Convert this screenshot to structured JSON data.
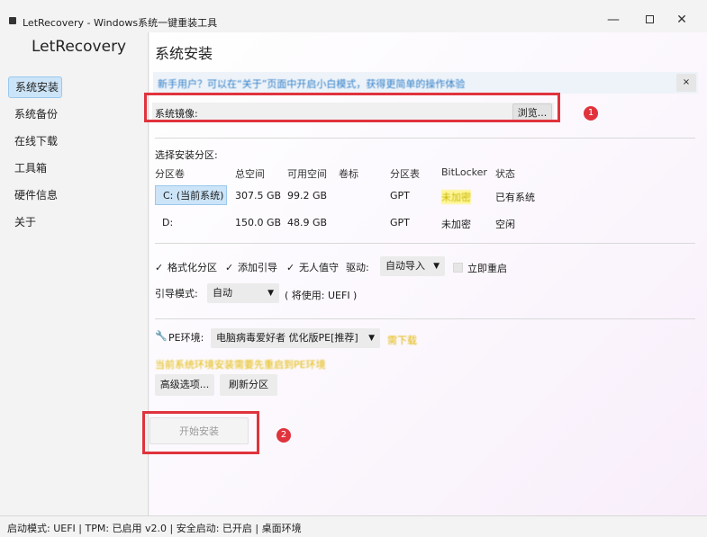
{
  "window": {
    "title": "LetRecovery - Windows系统一键重装工具"
  },
  "sidebar": {
    "app_name": "LetRecovery",
    "items": [
      {
        "label": "系统安装",
        "active": true
      },
      {
        "label": "系统备份"
      },
      {
        "label": "在线下载"
      },
      {
        "label": "工具箱"
      },
      {
        "label": "硬件信息"
      },
      {
        "label": "关于"
      }
    ]
  },
  "main": {
    "page_title": "系统安装",
    "tip": {
      "text": "新手用户？可以在“关于”页面中开启小白模式，获得更简单的操作体验",
      "close": "×"
    },
    "image_row": {
      "label": "系统镜像:",
      "browse_label": "浏览..."
    },
    "partition_section": {
      "label": "选择安装分区:"
    },
    "table": {
      "headers": [
        "分区卷",
        "总空间",
        "可用空间",
        "卷标",
        "分区表",
        "BitLocker",
        "状态"
      ],
      "rows": [
        {
          "volume": "C: (当前系统)",
          "total": "307.5 GB",
          "free": "99.2 GB",
          "label": "",
          "table": "GPT",
          "bitlocker": "未加密",
          "status": "已有系统",
          "selected": true
        },
        {
          "volume": "D:",
          "total": "150.0 GB",
          "free": "48.9 GB",
          "label": "",
          "table": "GPT",
          "bitlocker": "未加密",
          "status": "空闲",
          "selected": false
        }
      ]
    },
    "options": {
      "format": "格式化分区",
      "add_boot": "添加引导",
      "unattended": "无人值守",
      "driver_label": "驱动:",
      "driver_value": "自动导入",
      "reboot": "立即重启",
      "check_mark": "✓",
      "boot_mode_label": "引导模式:",
      "boot_mode_value": "自动",
      "boot_mode_note": "( 将使用: UEFI )"
    },
    "pe": {
      "label": "PE环境:",
      "value": "电脑病毒爱好者 优化版PE[推荐]",
      "download_link": "需下载",
      "warning": "当前系统环境安装需要先重启到PE环境"
    },
    "buttons": {
      "advanced": "高级选项...",
      "refresh": "刷新分区",
      "start": "开始安装"
    },
    "annotations": {
      "badge1": "1",
      "badge2": "2"
    }
  },
  "status_bar": {
    "text": "启动模式: UEFI | TPM: 已启用 v2.0 | 安全启动: 已开启 | 桌面环境"
  },
  "colors": {
    "accent": "#cce4f7",
    "annotation_red": "#e0333d",
    "warning_yellow": "#e2b700",
    "link_blue": "#2f7fc8"
  }
}
